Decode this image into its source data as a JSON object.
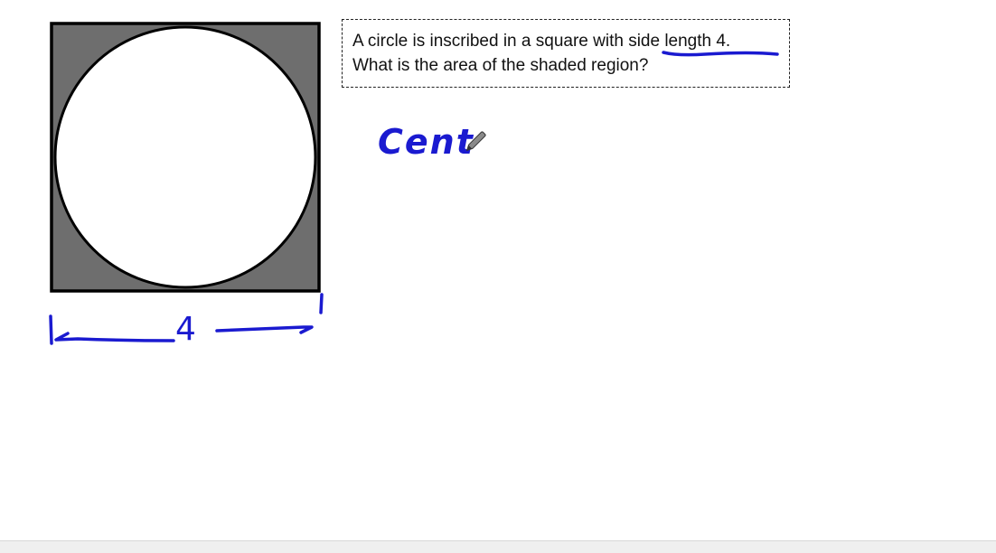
{
  "problem": {
    "line1": "A circle is inscribed in a square with side length 4.",
    "line2": "What is the area of the shaded region?"
  },
  "handwriting": {
    "side_label": "4",
    "work_text": "Cent"
  },
  "colors": {
    "shade": "#6e6e6e",
    "ink": "#1a1ad0",
    "outline": "#000000"
  },
  "icons": [
    "pen-cursor-icon"
  ]
}
